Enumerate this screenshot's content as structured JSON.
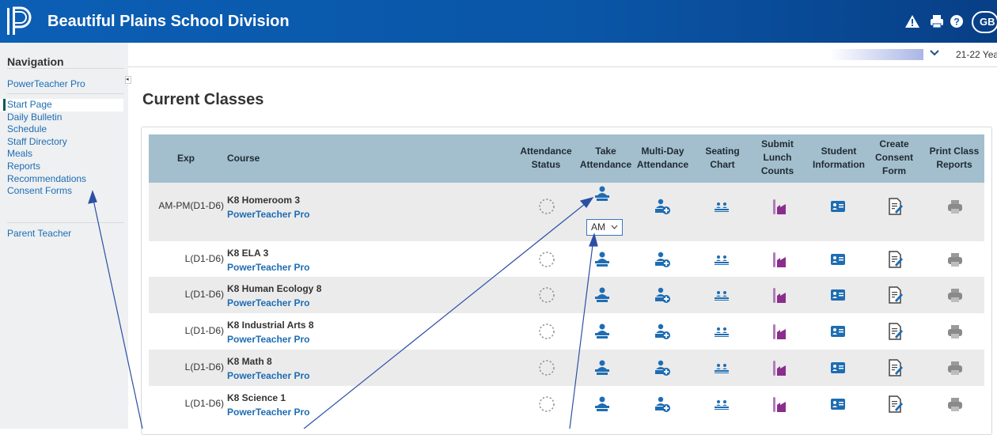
{
  "header": {
    "title": "Beautiful Plains School Division",
    "icons": [
      "alert-icon",
      "printer-icon",
      "help-icon"
    ],
    "avatar_initials": "GB",
    "brand_color": "#0b5fb5"
  },
  "nav": {
    "heading": "Navigation",
    "top_link": "PowerTeacher Pro",
    "items": [
      {
        "label": "Start Page",
        "active": true
      },
      {
        "label": "Daily Bulletin"
      },
      {
        "label": "Schedule"
      },
      {
        "label": "Staff Directory"
      },
      {
        "label": "Meals"
      },
      {
        "label": "Reports"
      },
      {
        "label": "Recommendations"
      },
      {
        "label": "Consent Forms"
      }
    ],
    "bottom_link": "Parent Teacher"
  },
  "topbar": {
    "term_label": "21-22 Yea"
  },
  "main": {
    "page_title": "Current Classes",
    "columns": {
      "exp": "Exp",
      "course": "Course",
      "attendance_status": [
        "Attendance",
        "Status"
      ],
      "take_attendance": [
        "Take",
        "Attendance"
      ],
      "multi_day": [
        "Multi-Day",
        "Attendance"
      ],
      "seating": [
        "Seating",
        "Chart"
      ],
      "lunch": [
        "Submit",
        "Lunch",
        "Counts"
      ],
      "student_info": [
        "Student",
        "Information"
      ],
      "consent": [
        "Create",
        "Consent",
        "Form"
      ],
      "print": [
        "Print Class",
        "Reports"
      ]
    },
    "am_select_value": "AM",
    "rows": [
      {
        "exp": "AM-PM(D1-D6)",
        "name": "K8 Homeroom 3",
        "link": "PowerTeacher Pro"
      },
      {
        "exp": "L(D1-D6)",
        "name": "K8 ELA 3",
        "link": "PowerTeacher Pro"
      },
      {
        "exp": "L(D1-D6)",
        "name": "K8 Human Ecology 8",
        "link": "PowerTeacher Pro"
      },
      {
        "exp": "L(D1-D6)",
        "name": "K8 Industrial Arts 8",
        "link": "PowerTeacher Pro"
      },
      {
        "exp": "L(D1-D6)",
        "name": "K8 Math 8",
        "link": "PowerTeacher Pro"
      },
      {
        "exp": "L(D1-D6)",
        "name": "K8 Science 1",
        "link": "PowerTeacher Pro"
      }
    ]
  },
  "colors": {
    "table_header": "#a3bfcd",
    "icon_blue": "#1e6db3",
    "lunch_purple": "#8a2d8c",
    "link_blue": "#1e6db3"
  }
}
